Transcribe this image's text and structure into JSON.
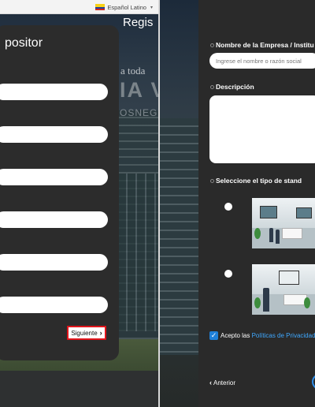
{
  "left": {
    "language": {
      "label": "Español Latino",
      "flag": "colombia-flag-icon"
    },
    "card_title": "positor",
    "background_text": {
      "line1": "a toda",
      "line2": "IA V",
      "line3": "OSNEG"
    },
    "input_count": 6,
    "next_button": "Siguiente"
  },
  "right": {
    "title": "Regis",
    "company_label": "Nombre de la Empresa / Institu",
    "company_placeholder": "Ingrese el nombre o razón social",
    "description_label": "Descripción",
    "stand_label": "Seleccione el tipo de stand",
    "privacy_prefix": "Acepto las",
    "privacy_link": "Políticas de Privacidad",
    "privacy_checked": true,
    "previous_button": "Anterior"
  },
  "colors": {
    "panel": "#2c2c2c",
    "accent_blue": "#1e7fd8",
    "link_blue": "#3fa8ff",
    "highlight_red": "#e0141b"
  }
}
